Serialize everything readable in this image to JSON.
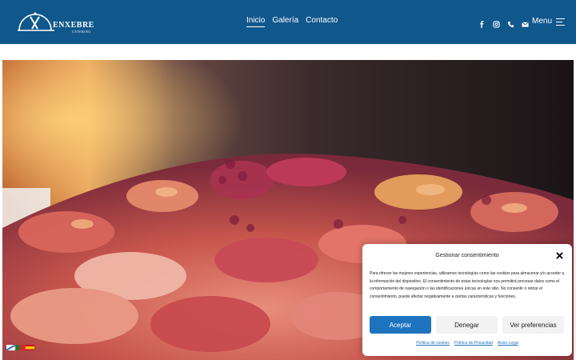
{
  "header": {
    "logo": {
      "name": "ENXEBRE",
      "tagline": "CATERING"
    },
    "nav": [
      {
        "label": "Inicio",
        "active": true
      },
      {
        "label": "Galería",
        "active": false
      },
      {
        "label": "Contacto",
        "active": false
      }
    ],
    "social_icons": [
      "facebook-icon",
      "instagram-icon",
      "phone-icon",
      "mail-icon"
    ],
    "menu_label": "Menu"
  },
  "hero": {
    "subject": "pulpo-photo"
  },
  "language_flags": [
    "galician-flag",
    "portuguese-flag",
    "spanish-flag"
  ],
  "consent": {
    "title": "Gestionar consentimiento",
    "text": "Para ofrecer las mejores experiencias, utilizamos tecnologías como las cookies para almacenar y/o acceder a la información del dispositivo. El consentimiento de estas tecnologías nos permitirá procesar datos como el comportamiento de navegación o las identificaciones únicas en este sitio. No consentir o retirar el consentimiento, puede afectar negativamente a ciertas características y funciones.",
    "buttons": {
      "accept": "Aceptar",
      "deny": "Denegar",
      "preferences": "Ver preferencias"
    },
    "links": [
      "Política de cookies",
      "Política de Privacidad",
      "Aviso Legal"
    ]
  },
  "colors": {
    "header_bg": "#10578c",
    "accent": "#1e73be",
    "button_secondary": "#f2f2f2"
  }
}
